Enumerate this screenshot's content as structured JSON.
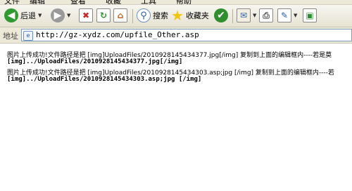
{
  "menu": {
    "items": [
      "文件",
      "编辑",
      "查看",
      "收藏",
      "工具",
      "帮助"
    ]
  },
  "toolbar": {
    "back_label": "后退",
    "search_label": "搜索",
    "favorites_label": "收藏夹"
  },
  "address": {
    "label": "地址",
    "url": "http://gz-xydz.com/upfile_Other.asp"
  },
  "content": {
    "line1": "图片上传成功!文件路径是把 [img]UploadFiles/2010928145434377.jpg[/img] 复制到上面的编辑框内----若是莫",
    "line2": "[img]../UploadFiles/2010928145434377.jpg[/img]",
    "line3": "图片上传成功!文件路径是把 [img]UploadFiles/2010928145434303.asp;jpg [/img] 复制到上面的编辑框内----若",
    "line4": "[img]../UploadFiles/2010928145434303.asp;jpg [/img]"
  },
  "colors": {
    "back": "#2f9a2f",
    "forward": "#9a9a9a",
    "stop": "#c62828",
    "refresh": "#2f8f2f",
    "favorites_star": "#f1c40f",
    "history": "#2f8f2f"
  },
  "icons": [
    "back-icon",
    "forward-icon",
    "stop-icon",
    "refresh-icon",
    "home-icon",
    "search-icon",
    "favorites-star-icon",
    "history-icon",
    "mail-icon",
    "print-icon",
    "edit-icon",
    "discuss-icon"
  ]
}
